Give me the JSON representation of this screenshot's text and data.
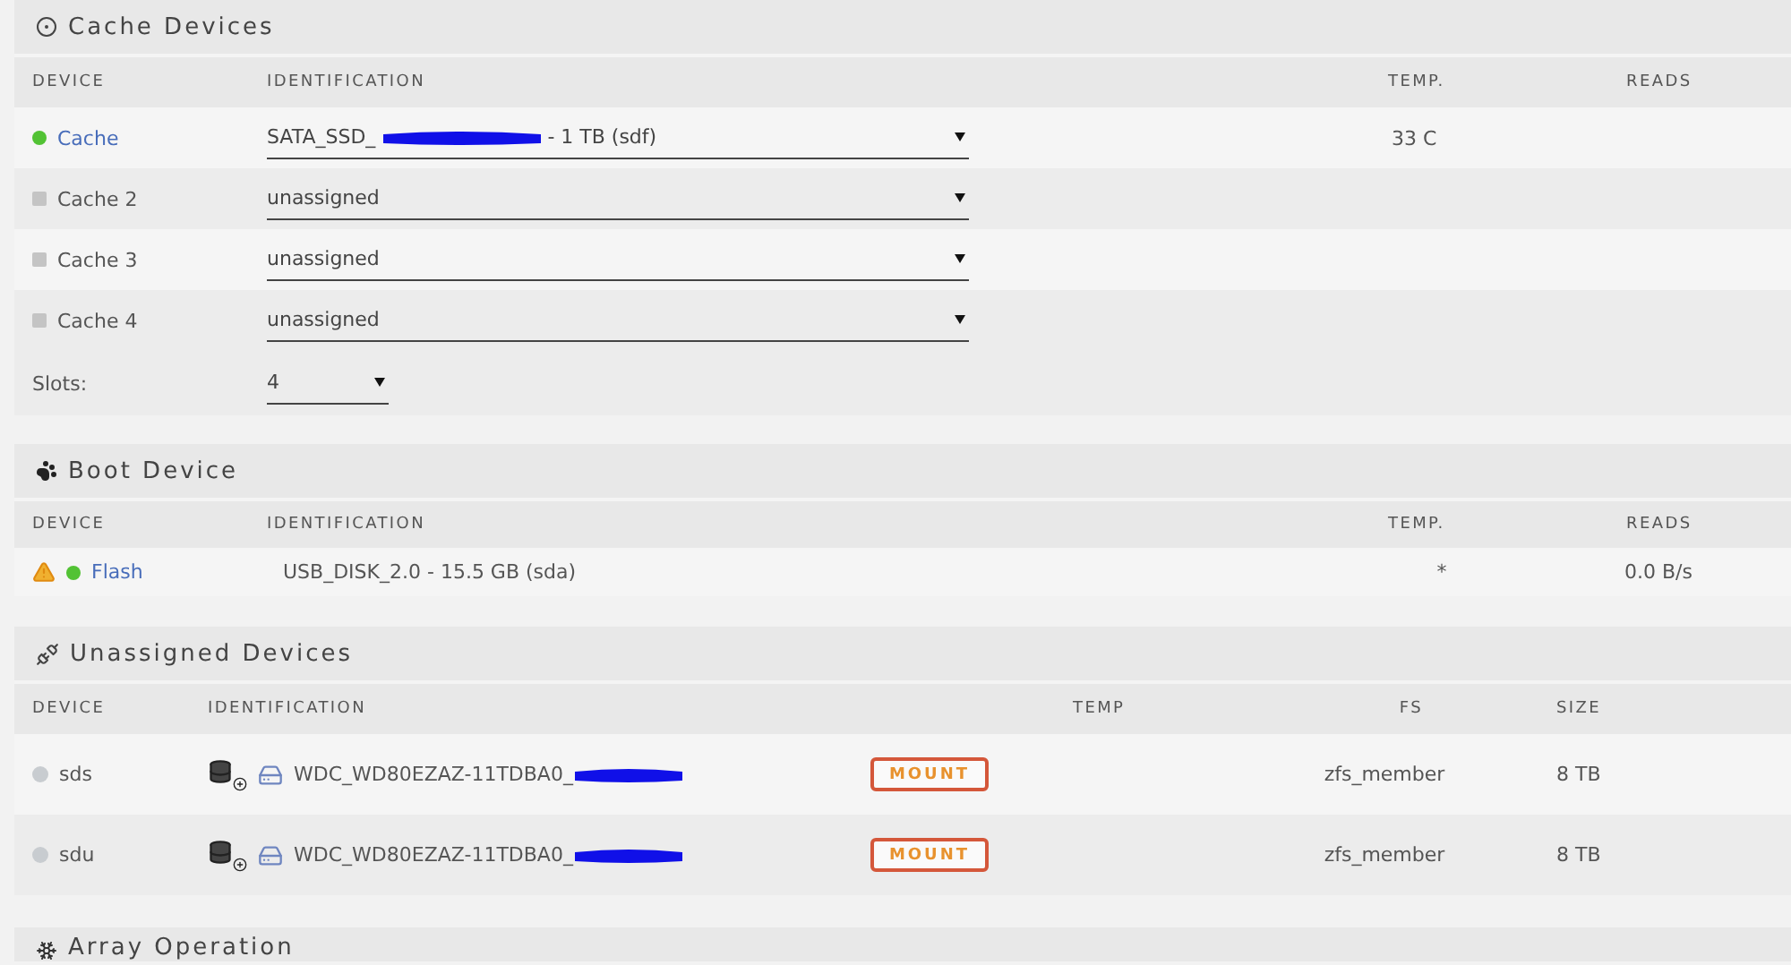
{
  "cache_devices": {
    "title": "Cache Devices",
    "columns": [
      "DEVICE",
      "IDENTIFICATION",
      "TEMP.",
      "READS"
    ],
    "rows": [
      {
        "device": "Cache",
        "kind": "dot",
        "color": "#52c234",
        "link": true,
        "value_prefix": "SATA_SSD_",
        "redacted": true,
        "value_suffix": "- 1 TB (sdf)",
        "temp": "33 C"
      },
      {
        "device": "Cache 2",
        "kind": "square",
        "color": "#c4c4c4",
        "link": false,
        "value_prefix": "unassigned",
        "redacted": false
      },
      {
        "device": "Cache 3",
        "kind": "square",
        "color": "#c4c4c4",
        "link": false,
        "value_prefix": "unassigned",
        "redacted": false
      },
      {
        "device": "Cache 4",
        "kind": "square",
        "color": "#c4c4c4",
        "link": false,
        "value_prefix": "unassigned",
        "redacted": false
      }
    ],
    "slots": {
      "label": "Slots:",
      "value": "4"
    }
  },
  "boot_device": {
    "title": "Boot Device",
    "columns": [
      "DEVICE",
      "IDENTIFICATION",
      "TEMP.",
      "READS"
    ],
    "rows": [
      {
        "warning": true,
        "device": "Flash",
        "kind": "dot",
        "color": "#52c234",
        "identification": "USB_DISK_2.0 - 15.5 GB (sda)",
        "temp": "*",
        "reads": "0.0 B/s"
      }
    ]
  },
  "unassigned_devices": {
    "title": "Unassigned Devices",
    "columns": [
      "DEVICE",
      "IDENTIFICATION",
      "TEMP",
      "FS",
      "SIZE"
    ],
    "rows": [
      {
        "device": "sds",
        "color": "#c8ccd0",
        "identification": "WDC_WD80EZAZ-11TDBA0_",
        "redacted": true,
        "action": "MOUNT",
        "fs": "zfs_member",
        "size": "8 TB"
      },
      {
        "device": "sdu",
        "color": "#c8ccd0",
        "identification": "WDC_WD80EZAZ-11TDBA0_",
        "redacted": true,
        "action": "MOUNT",
        "fs": "zfs_member",
        "size": "8 TB"
      }
    ]
  },
  "array_operation": {
    "title": "Array Operation"
  }
}
